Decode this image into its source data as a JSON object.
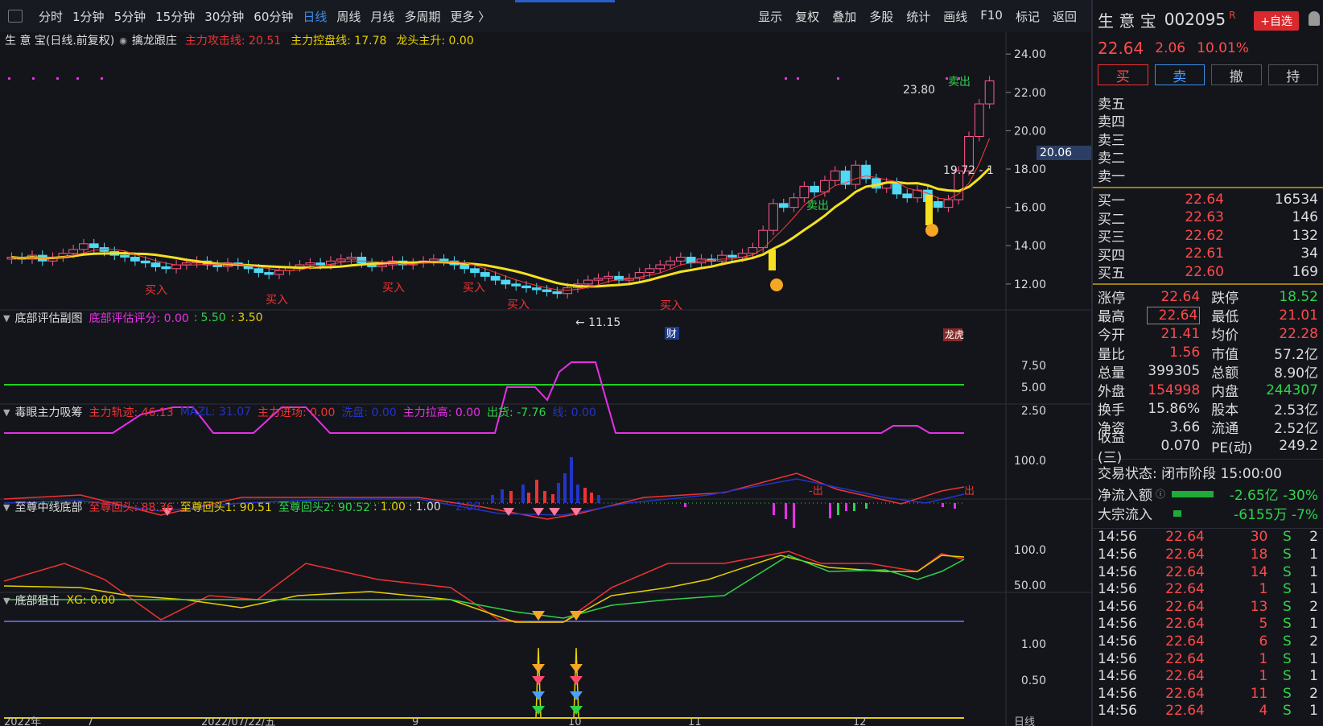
{
  "toolbar": {
    "periods": [
      "分时",
      "1分钟",
      "5分钟",
      "15分钟",
      "30分钟",
      "60分钟",
      "日线",
      "周线",
      "月线",
      "多周期",
      "更多 〉"
    ],
    "active_period": "日线",
    "right_menu": [
      "显示",
      "复权",
      "叠加",
      "多股",
      "统计",
      "画线",
      "F10",
      "标记",
      "返回"
    ]
  },
  "main_chart": {
    "title": "生 意 宝(日线.前复权)",
    "indicator": "擒龙跟庄",
    "line1": "主力攻击线: 20.51",
    "line2": "主力控盘线: 17.78",
    "line3": "龙头主升: 0.00",
    "y_ticks": [
      "24.00",
      "22.00",
      "20.00",
      "18.00",
      "16.00",
      "14.00",
      "12.00"
    ],
    "price_tag": "20.06",
    "high_label": "23.80",
    "low_label": "11.15",
    "ref_label": "19.72 - 1",
    "sell_labels": [
      "卖出",
      "卖出"
    ],
    "buy_labels": [
      "买入",
      "买入",
      "买入",
      "买入",
      "买入",
      "买入"
    ],
    "cai": "财",
    "longhu": "龙虎"
  },
  "chart_data": {
    "type": "candlestick",
    "x_ticks": [
      "2022年",
      "7",
      "2022/07/22/五",
      "9",
      "10",
      "11",
      "12",
      "日线"
    ],
    "close": [
      13.4,
      13.3,
      13.5,
      13.2,
      13.4,
      13.6,
      13.8,
      14.1,
      13.9,
      13.7,
      13.5,
      13.4,
      13.2,
      13.1,
      12.9,
      12.8,
      13.0,
      13.1,
      13.2,
      13.0,
      12.9,
      13.1,
      13.0,
      12.8,
      12.6,
      12.5,
      12.7,
      12.9,
      13.0,
      13.1,
      13.0,
      13.2,
      13.3,
      13.4,
      13.1,
      12.9,
      13.0,
      13.2,
      13.0,
      13.1,
      13.2,
      13.3,
      13.2,
      13.0,
      12.8,
      12.6,
      12.4,
      12.2,
      12.0,
      11.9,
      11.8,
      11.7,
      11.6,
      11.5,
      11.8,
      12.0,
      12.2,
      12.3,
      12.4,
      12.2,
      12.3,
      12.6,
      12.8,
      13.0,
      13.2,
      13.4,
      13.1,
      13.3,
      13.2,
      13.5,
      13.4,
      13.6,
      13.9,
      14.8,
      16.2,
      16.0,
      16.5,
      17.1,
      16.8,
      17.4,
      17.9,
      17.2,
      18.2,
      17.5,
      17.0,
      17.3,
      16.7,
      16.5,
      16.9,
      16.3,
      16.0,
      16.4,
      17.9,
      19.7,
      21.4,
      22.6
    ],
    "attack_line": 20.51,
    "control_line": 17.78,
    "sub1": {
      "title": "底部评估副图",
      "score": "底部评估评分: 0.00",
      "v2": "5.50",
      "v3": "3.50",
      "y_ticks": [
        "7.50",
        "5.00",
        "2.50"
      ]
    },
    "sub2": {
      "title": "毒眼主力吸筹",
      "a": "主力轨迹: 46.13",
      "b": "MAZL: 31.07",
      "c": "主力进场: 0.00",
      "d": "洗盘: 0.00",
      "e": "主力拉高: 0.00",
      "f": "出货: -7.76",
      "g": "线: 0.00",
      "y_ticks": [
        "100.0"
      ]
    },
    "sub3": {
      "title": "至尊中线底部",
      "a": "至尊回头: 88.36",
      "b": "至尊回头1: 90.51",
      "c": "至尊回头2: 90.52",
      "d": "1.00",
      "e": "1.00",
      "f": "2.00",
      "y_ticks": [
        "100.0",
        "50.00"
      ]
    },
    "sub4": {
      "title": "底部狙击",
      "a": "XG: 0.00",
      "y_ticks": [
        "1.00",
        "0.50"
      ]
    }
  },
  "quote": {
    "name": "生 意 宝",
    "code": "002095",
    "r_mark": "R",
    "zixuan": "+自选",
    "price": "22.64",
    "change": "2.06",
    "pct": "10.01%",
    "buttons": [
      "买",
      "卖",
      "撤",
      "持"
    ],
    "asks": [
      [
        "卖五",
        "",
        ""
      ],
      [
        "卖四",
        "",
        ""
      ],
      [
        "卖三",
        "",
        ""
      ],
      [
        "卖二",
        "",
        ""
      ],
      [
        "卖一",
        "",
        ""
      ]
    ],
    "bids": [
      [
        "买一",
        "22.64",
        "16534"
      ],
      [
        "买二",
        "22.63",
        "146"
      ],
      [
        "买三",
        "22.62",
        "132"
      ],
      [
        "买四",
        "22.61",
        "34"
      ],
      [
        "买五",
        "22.60",
        "169"
      ]
    ],
    "stats": [
      [
        "涨停",
        "22.64",
        "跌停",
        "18.52"
      ],
      [
        "最高",
        "22.64",
        "最低",
        "21.01"
      ],
      [
        "今开",
        "21.41",
        "均价",
        "22.28"
      ],
      [
        "量比",
        "1.56",
        "市值",
        "57.2亿"
      ],
      [
        "总量",
        "399305",
        "总额",
        "8.90亿"
      ],
      [
        "外盘",
        "154998",
        "内盘",
        "244307"
      ],
      [
        "换手",
        "15.86%",
        "股本",
        "2.53亿"
      ],
      [
        "净资",
        "3.66",
        "流通",
        "2.52亿"
      ],
      [
        "收益(三)",
        "0.070",
        "PE(动)",
        "249.2"
      ]
    ],
    "status": "交易状态: 闭市阶段 15:00:00",
    "flow1_label": "净流入额",
    "flow1_val": "-2.65亿 -30%",
    "flow2_label": "大宗流入",
    "flow2_val": "-6155万  -7%",
    "ticks": [
      [
        "14:56",
        "22.64",
        "30",
        "S",
        "2"
      ],
      [
        "14:56",
        "22.64",
        "18",
        "S",
        "1"
      ],
      [
        "14:56",
        "22.64",
        "14",
        "S",
        "1"
      ],
      [
        "14:56",
        "22.64",
        "1",
        "S",
        "1"
      ],
      [
        "14:56",
        "22.64",
        "13",
        "S",
        "2"
      ],
      [
        "14:56",
        "22.64",
        "5",
        "S",
        "1"
      ],
      [
        "14:56",
        "22.64",
        "6",
        "S",
        "2"
      ],
      [
        "14:56",
        "22.64",
        "1",
        "S",
        "1"
      ],
      [
        "14:56",
        "22.64",
        "1",
        "S",
        "1"
      ],
      [
        "14:56",
        "22.64",
        "11",
        "S",
        "2"
      ],
      [
        "14:56",
        "22.64",
        "4",
        "S",
        "1"
      ]
    ]
  }
}
